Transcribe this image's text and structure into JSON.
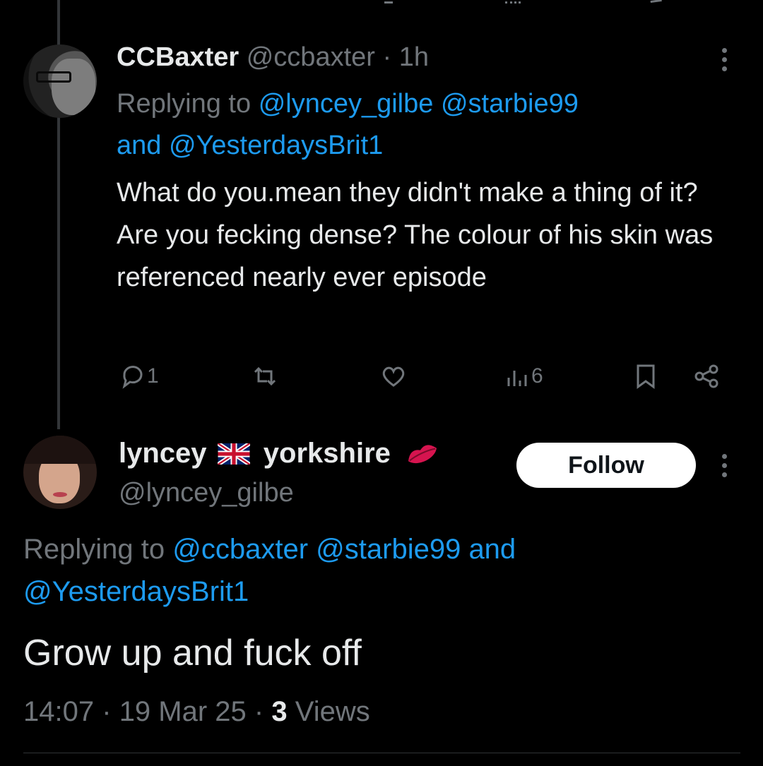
{
  "tweet1": {
    "display_name": "CCBaxter",
    "handle": "@ccbaxter",
    "separator": "·",
    "time": "1h",
    "replying_label": "Replying to",
    "reply_to_1": "@lyncey_gilbe",
    "reply_to_2": "@starbie99",
    "reply_and": "and",
    "reply_to_3": "@YesterdaysBrit1",
    "body": "What do you.mean they didn't make a thing of it? Are you fecking dense? The colour of his skin was referenced nearly ever episode",
    "actions": {
      "reply_count": "1",
      "retweet_count": "",
      "like_count": "",
      "views_count": "6"
    }
  },
  "tweet2": {
    "display_name_part1": "lyncey",
    "display_name_part2": "yorkshire",
    "handle": "@lyncey_gilbe",
    "follow_label": "Follow",
    "replying_label": "Replying to",
    "reply_to_1": "@ccbaxter",
    "reply_to_2": "@starbie99",
    "reply_and": "and",
    "reply_to_3": "@YesterdaysBrit1",
    "body": "Grow up and fuck off",
    "time": "14:07",
    "sep1": "·",
    "date": "19 Mar 25",
    "sep2": "·",
    "views_count": "3",
    "views_label": "Views"
  },
  "icons": {
    "reply": "reply-icon",
    "retweet": "retweet-icon",
    "like": "heart-icon",
    "views": "views-icon",
    "bookmark": "bookmark-icon",
    "share": "share-icon",
    "more": "more-icon",
    "flag": "uk-flag-icon",
    "lips": "lips-icon"
  },
  "colors": {
    "background": "#000000",
    "text": "#e7e9ea",
    "muted": "#71767b",
    "link": "#1d9bf0",
    "follow_bg": "#ffffff"
  }
}
